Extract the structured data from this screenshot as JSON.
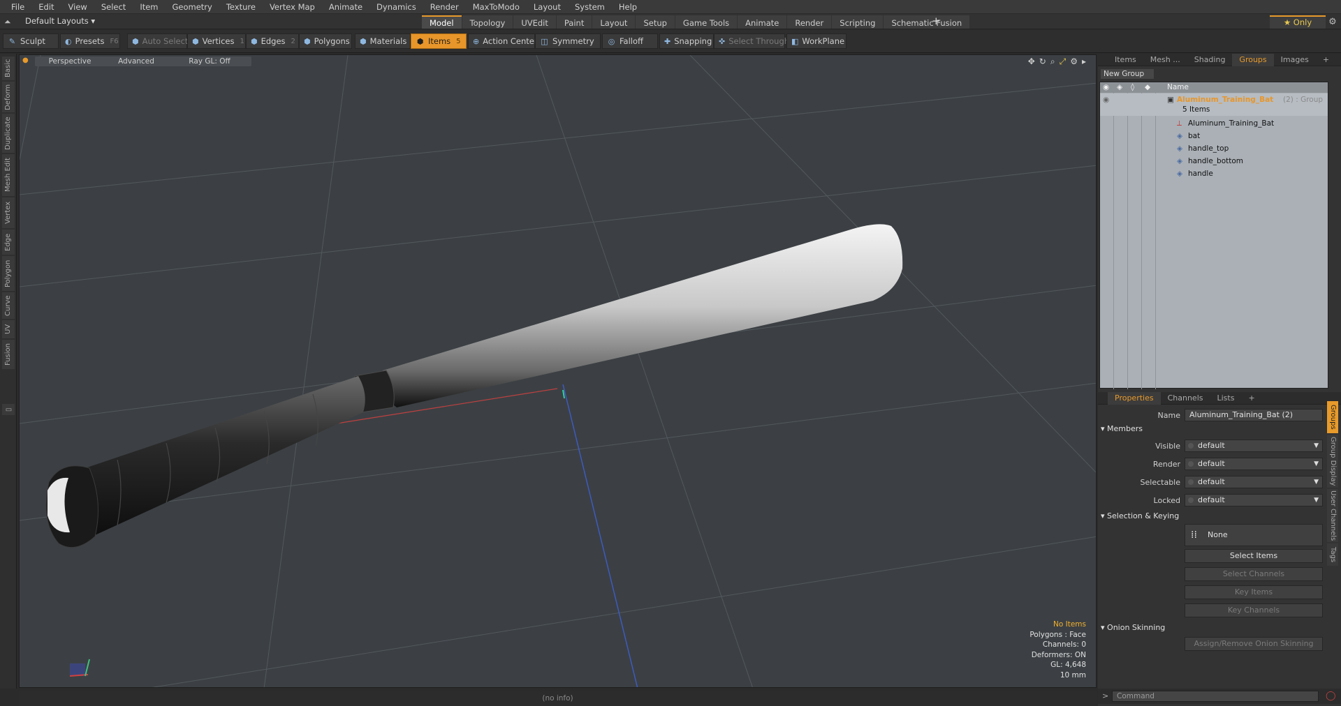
{
  "menubar": [
    "File",
    "Edit",
    "View",
    "Select",
    "Item",
    "Geometry",
    "Texture",
    "Vertex Map",
    "Animate",
    "Dynamics",
    "Render",
    "MaxToModo",
    "Layout",
    "System",
    "Help"
  ],
  "layout": {
    "select_label": "Default Layouts ▾"
  },
  "mode_tabs": [
    "Model",
    "Topology",
    "UVEdit",
    "Paint",
    "Layout",
    "Setup",
    "Game Tools",
    "Animate",
    "Render",
    "Scripting",
    "Schematic Fusion"
  ],
  "only_label": "★  Only",
  "toolbar": {
    "sculpt": "Sculpt",
    "presets": "Presets",
    "presets_key": "F6",
    "auto_select": "Auto Select",
    "vertices": "Vertices",
    "vertices_key": "1",
    "edges": "Edges",
    "edges_key": "2",
    "polygons": "Polygons",
    "materials": "Materials",
    "items": "Items",
    "items_key": "5",
    "action_center": "Action Center",
    "symmetry": "Symmetry",
    "falloff": "Falloff",
    "snapping": "Snapping",
    "select_through": "Select Through",
    "workplane": "WorkPlane"
  },
  "left_tabs": [
    "Basic",
    "Deform",
    "Duplicate",
    "Mesh Edit",
    "Vertex",
    "Edge",
    "Polygon",
    "Curve",
    "UV",
    "Fusion"
  ],
  "viewport": {
    "view_mode": "Perspective",
    "shading": "Advanced",
    "raygl": "Ray GL: Off",
    "info": {
      "no_items": "No Items",
      "polygons": "Polygons : Face",
      "channels": "Channels: 0",
      "deformers": "Deformers: ON",
      "gl": "GL: 4,648",
      "scale": "10 mm"
    }
  },
  "status": "(no info)",
  "top_panel": {
    "tabs": [
      "Items",
      "Mesh ...",
      "Shading",
      "Groups",
      "Images"
    ],
    "active_tab": "Groups",
    "new_group": "New Group",
    "col_name": "Name",
    "group": {
      "name": "Aluminum_Training_Bat",
      "suffix": "(2) : Group",
      "count": "5 Items"
    },
    "children": [
      "Aluminum_Training_Bat",
      "bat",
      "handle_top",
      "handle_bottom",
      "handle"
    ]
  },
  "props_panel": {
    "tabs": [
      "Properties",
      "Channels",
      "Lists"
    ],
    "name_label": "Name",
    "name_value": "Aluminum_Training_Bat (2)",
    "members_section": "Members",
    "visible_label": "Visible",
    "visible_value": "default",
    "render_label": "Render",
    "render_value": "default",
    "selectable_label": "Selectable",
    "selectable_value": "default",
    "locked_label": "Locked",
    "locked_value": "default",
    "selection_section": "Selection & Keying",
    "none_label": "None",
    "select_items": "Select Items",
    "select_channels": "Select Channels",
    "key_items": "Key Items",
    "key_channels": "Key Channels",
    "onion_section": "Onion Skinning",
    "assign_onion": "Assign/Remove Onion Skinning",
    "side_tabs": [
      "Groups",
      "Group Display",
      "User Channels",
      "Tags"
    ]
  },
  "command": {
    "placeholder": "Command"
  }
}
